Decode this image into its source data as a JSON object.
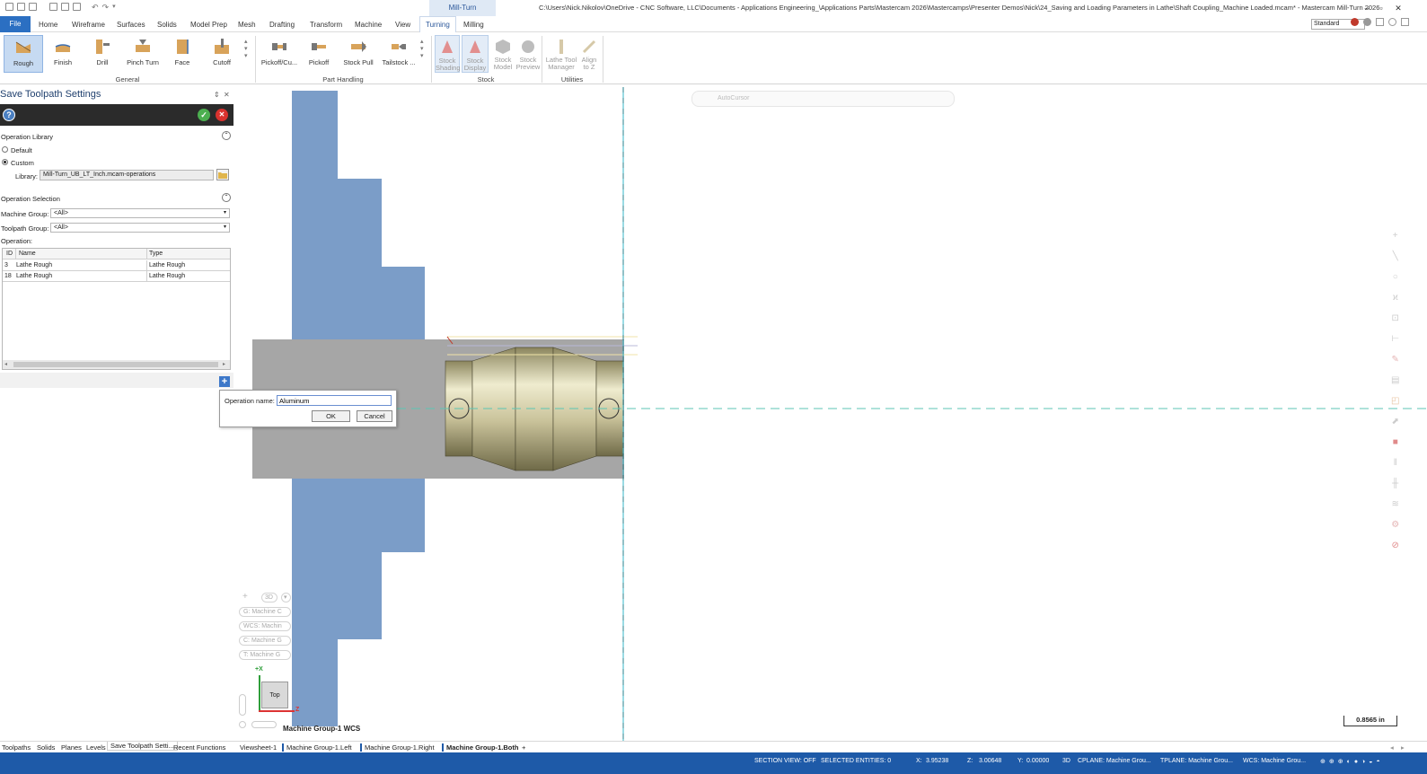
{
  "window": {
    "context_tab": "Mill-Turn",
    "title": "C:\\Users\\Nick.Nikolov\\OneDrive - CNC Software, LLC\\Documents - Applications Engineering_\\Applications Parts\\Mastercam 2026\\Mastercamps\\Presenter Demos\\Nick\\24_Saving and Loading Parameters in Lathe\\Shaft Coupling_Machine Loaded.mcam* - Mastercam Mill-Turn 2026",
    "minimize": "–",
    "restore": "▫",
    "close": "✕"
  },
  "ribbon_tabs": [
    {
      "label": "File"
    },
    {
      "label": "Home"
    },
    {
      "label": "Wireframe"
    },
    {
      "label": "Surfaces"
    },
    {
      "label": "Solids"
    },
    {
      "label": "Model Prep"
    },
    {
      "label": "Mesh"
    },
    {
      "label": "Drafting"
    },
    {
      "label": "Transform"
    },
    {
      "label": "Machine"
    },
    {
      "label": "View"
    },
    {
      "label": "Turning"
    },
    {
      "label": "Milling"
    }
  ],
  "style_select": "Standard",
  "ribbon": {
    "general": {
      "label": "General",
      "buttons": [
        "Rough",
        "Finish",
        "Drill",
        "Pinch Turn",
        "Face",
        "Cutoff"
      ]
    },
    "part_handling": {
      "label": "Part Handling",
      "buttons": [
        "Pickoff/Cu...",
        "Pickoff",
        "Stock Pull",
        "Tailstock ..."
      ]
    },
    "stock": {
      "label": "Stock",
      "buttons": [
        [
          "Stock",
          "Shading"
        ],
        [
          "Stock",
          "Display"
        ],
        [
          "Stock",
          "Model"
        ],
        [
          "Stock",
          "Preview"
        ]
      ]
    },
    "utilities": {
      "label": "Utilities",
      "buttons": [
        [
          "Lathe Tool",
          "Manager"
        ],
        [
          "Align",
          "to Z"
        ]
      ]
    }
  },
  "panel": {
    "title": "Save Toolpath Settings",
    "pin": "⇕",
    "close": "✕",
    "help": "?",
    "ok": "✓",
    "cancel": "✕",
    "operation_library": {
      "title": "Operation Library",
      "default_label": "Default",
      "custom_label": "Custom",
      "selected": "Custom",
      "library_label": "Library:",
      "library_value": "Mill-Turn_UB_LT_Inch.mcam-operations"
    },
    "operation_selection": {
      "title": "Operation Selection",
      "machine_group_label": "Machine Group:",
      "machine_group_value": "<All>",
      "toolpath_group_label": "Toolpath Group:",
      "toolpath_group_value": "<All>",
      "operation_label": "Operation:",
      "columns": [
        "ID",
        "Name",
        "Type"
      ],
      "rows": [
        {
          "id": "3",
          "name": "Lathe Rough",
          "type": "Lathe Rough"
        },
        {
          "id": "18",
          "name": "Lathe Rough",
          "type": "Lathe Rough"
        }
      ]
    }
  },
  "dialog": {
    "label": "Operation name:",
    "value": "Aluminum",
    "ok": "OK",
    "cancel": "Cancel"
  },
  "viewport": {
    "autocursor": "AutoCursor",
    "view_label": "Machine Group-1 WCS",
    "scale": "0.8565 in",
    "gnomon_top": "Top",
    "axis_x": "+X",
    "axis_z": "Z",
    "controls": {
      "mode": "3D",
      "g": "G: Machine C",
      "wcs": "WCS: Machin",
      "c": "C: Machine G",
      "t": "T: Machine G"
    }
  },
  "bottom_tabs": [
    "Toolpaths",
    "Solids",
    "Planes",
    "Levels",
    "Save Toolpath Setti...",
    "Recent Functions"
  ],
  "view_tabs": [
    "Viewsheet-1",
    "Machine Group-1.Left",
    "Machine Group-1.Right",
    "Machine Group-1.Both",
    "+"
  ],
  "status": {
    "section_view": "SECTION VIEW: OFF",
    "selected": "SELECTED ENTITIES: 0",
    "x": "X:",
    "x_val": "3.95238",
    "z": "Z:",
    "z_val": "3.00648",
    "y": "Y:",
    "y_val": "0.00000",
    "mode": "3D",
    "cplane": "CPLANE: Machine Grou...",
    "tplane": "TPLANE: Machine Grou...",
    "wcs": "WCS: Machine Grou..."
  },
  "colors": {
    "accent": "#2b6fc2",
    "statusbar": "#1e5aa8",
    "stock": "#7b9dc8",
    "chuck": "#a6a6a6",
    "part": "#c9c29a"
  }
}
